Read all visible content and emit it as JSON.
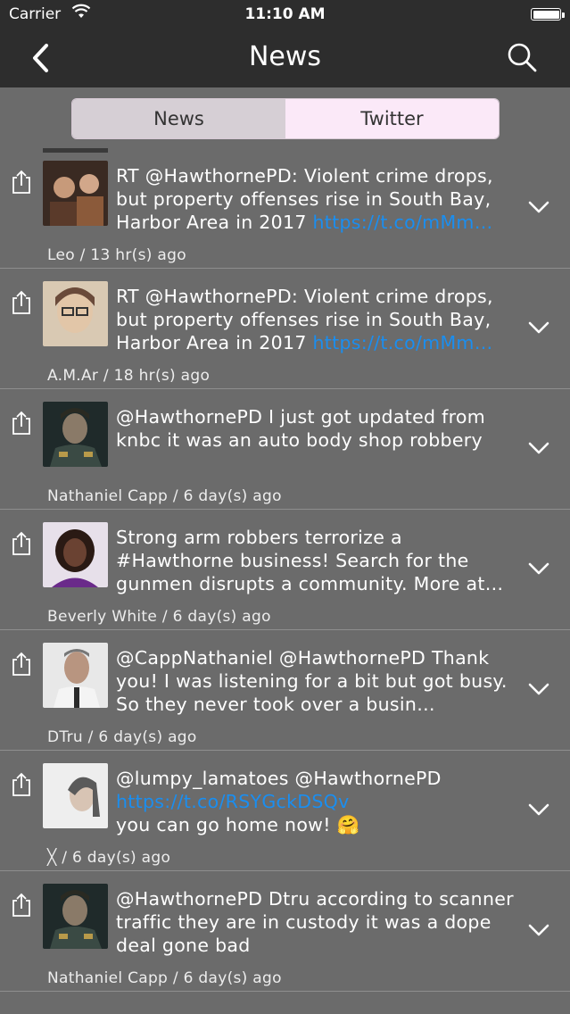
{
  "status": {
    "carrier": "Carrier",
    "time": "11:10 AM"
  },
  "nav": {
    "title": "News",
    "back_icon": "chevron-left-icon",
    "search_icon": "search-icon"
  },
  "segments": {
    "news": "News",
    "twitter": "Twitter",
    "selected": "Twitter"
  },
  "tweets": [
    {
      "text": "RT @HawthornePD: Violent crime drops, but property offenses rise in South Bay, Harbor Area in 2017",
      "link": "https://t.co/mMm…",
      "meta": "Leo / 13 hr(s) ago",
      "avatar_colors": [
        "#5a3a2a",
        "#c79a7a",
        "#8b5a3a"
      ]
    },
    {
      "text": "RT @HawthornePD: Violent crime drops, but property offenses rise in South Bay, Harbor Area in 2017",
      "link": "https://t.co/mMm…",
      "meta": "A.M.Ar / 18 hr(s) ago",
      "avatar_colors": [
        "#d9c9b3",
        "#6a4a3a",
        "#b8a591"
      ]
    },
    {
      "text": "@HawthornePD I just got updated from knbc it was an auto body shop robbery",
      "link": "",
      "meta": "Nathaniel Capp / 6 day(s) ago",
      "avatar_colors": [
        "#1f2a2a",
        "#6f7c5a",
        "#3a4a44"
      ]
    },
    {
      "text": "Strong arm robbers terrorize a #Hawthorne business! Search for the gunmen disrupts a community. More at…",
      "link": "",
      "meta": "Beverly White / 6 day(s) ago",
      "avatar_colors": [
        "#e7e0ea",
        "#3a2620",
        "#6a2a8a"
      ]
    },
    {
      "text": "@CappNathaniel @HawthornePD Thank you! I was listening for a bit but got busy. So they never took over a  busin…",
      "link": "",
      "meta": "DTru / 6 day(s) ago",
      "avatar_colors": [
        "#e8e8e8",
        "#b89580",
        "#2a2a2a"
      ]
    },
    {
      "text": "@lumpy_lamatoes @HawthornePD",
      "link": "https://t.co/RSYGckDSQv",
      "text2": "you can go home now! 🤗",
      "meta": "╳ / 6 day(s) ago",
      "avatar_colors": [
        "#eeeeee",
        "#cccccc",
        "#5a5a5a"
      ]
    },
    {
      "text": "@HawthornePD Dtru according to scanner traffic they are in custody it was a dope deal gone bad",
      "link": "",
      "meta": "Nathaniel Capp / 6 day(s) ago",
      "avatar_colors": [
        "#1f2a2a",
        "#6f7c5a",
        "#3a4a44"
      ]
    }
  ],
  "icons": {
    "share": "share-icon",
    "expand": "chevron-down-icon",
    "wifi": "wifi-icon",
    "battery": "battery-icon"
  }
}
